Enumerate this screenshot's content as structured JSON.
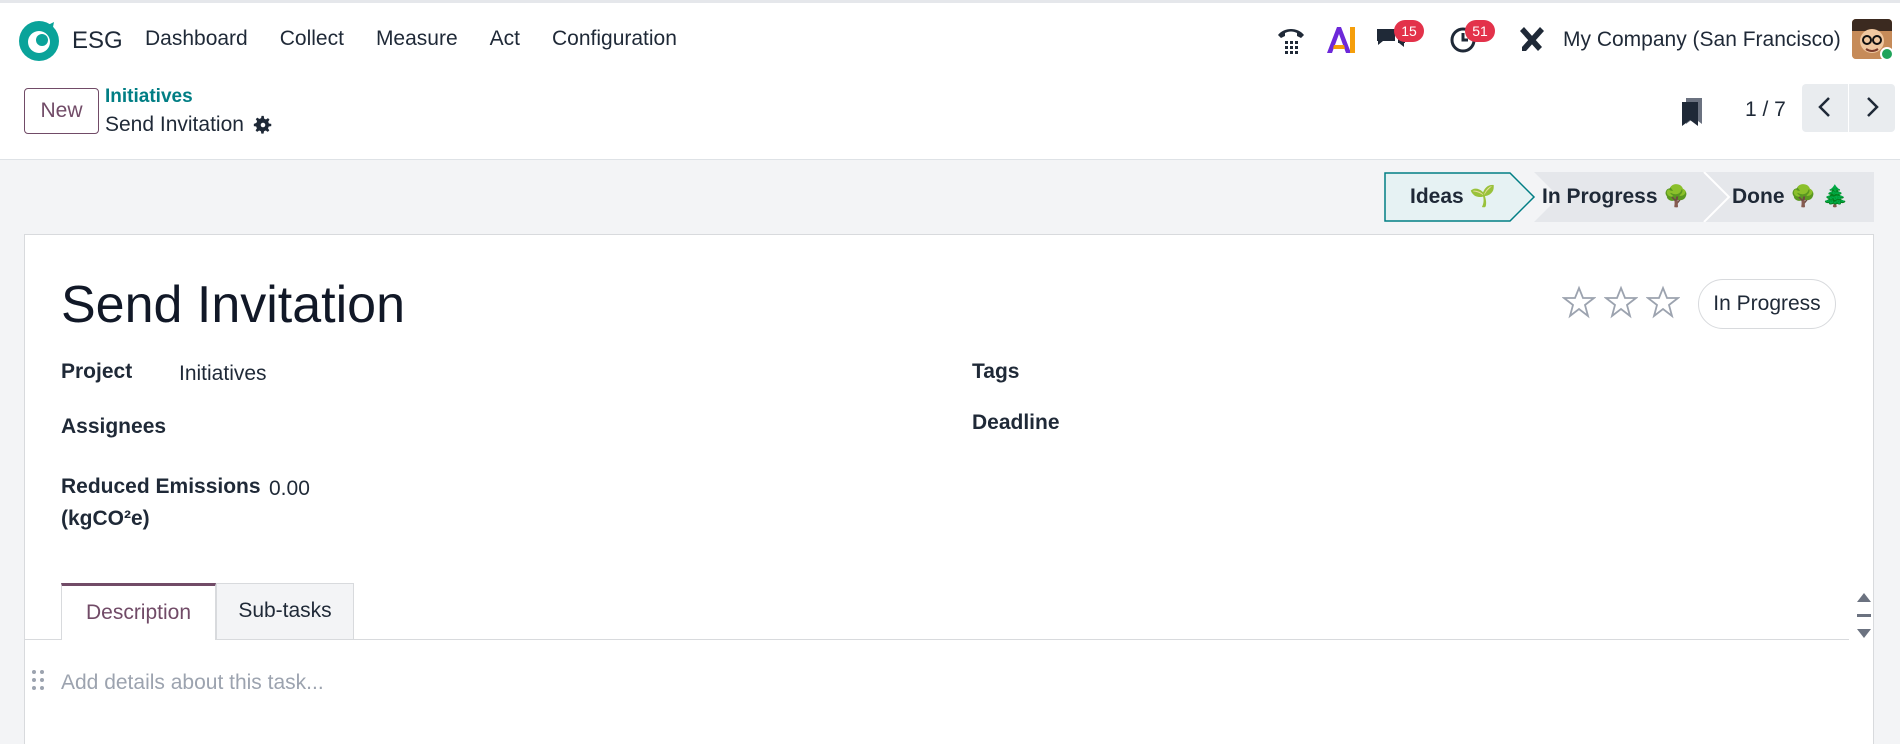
{
  "app": {
    "name": "ESG",
    "brand_color": "#017e84",
    "accent_color": "#714b67"
  },
  "menu": [
    "Dashboard",
    "Collect",
    "Measure",
    "Act",
    "Configuration"
  ],
  "systray": {
    "icons": [
      "phone-icon",
      "ai-icon",
      "chat-icon",
      "activity-clock-icon",
      "tools-icon"
    ],
    "messages_badge": "15",
    "activities_badge": "51",
    "company": "My Company (San Francisco)"
  },
  "control": {
    "new_label": "New",
    "breadcrumb_parent": "Initiatives",
    "breadcrumb_current": "Send Invitation",
    "pager_value": "1 / 7"
  },
  "stages": [
    {
      "label": "Ideas",
      "emoji": "🌱",
      "active": true
    },
    {
      "label": "In Progress",
      "emoji": "🌳",
      "active": false
    },
    {
      "label": "Done",
      "emoji": "🌳 🌲",
      "active": false
    }
  ],
  "record": {
    "title": "Send Invitation",
    "state": "In Progress",
    "priority_stars": 0,
    "fields": {
      "project_label": "Project",
      "project_value": "Initiatives",
      "assignees_label": "Assignees",
      "emissions_label_line1": "Reduced Emissions",
      "emissions_label_line2": "(kgCO²e)",
      "emissions_value": "0.00",
      "tags_label": "Tags",
      "deadline_label": "Deadline"
    }
  },
  "tabs": [
    "Description",
    "Sub-tasks"
  ],
  "editor": {
    "placeholder": "Add details about this task..."
  }
}
